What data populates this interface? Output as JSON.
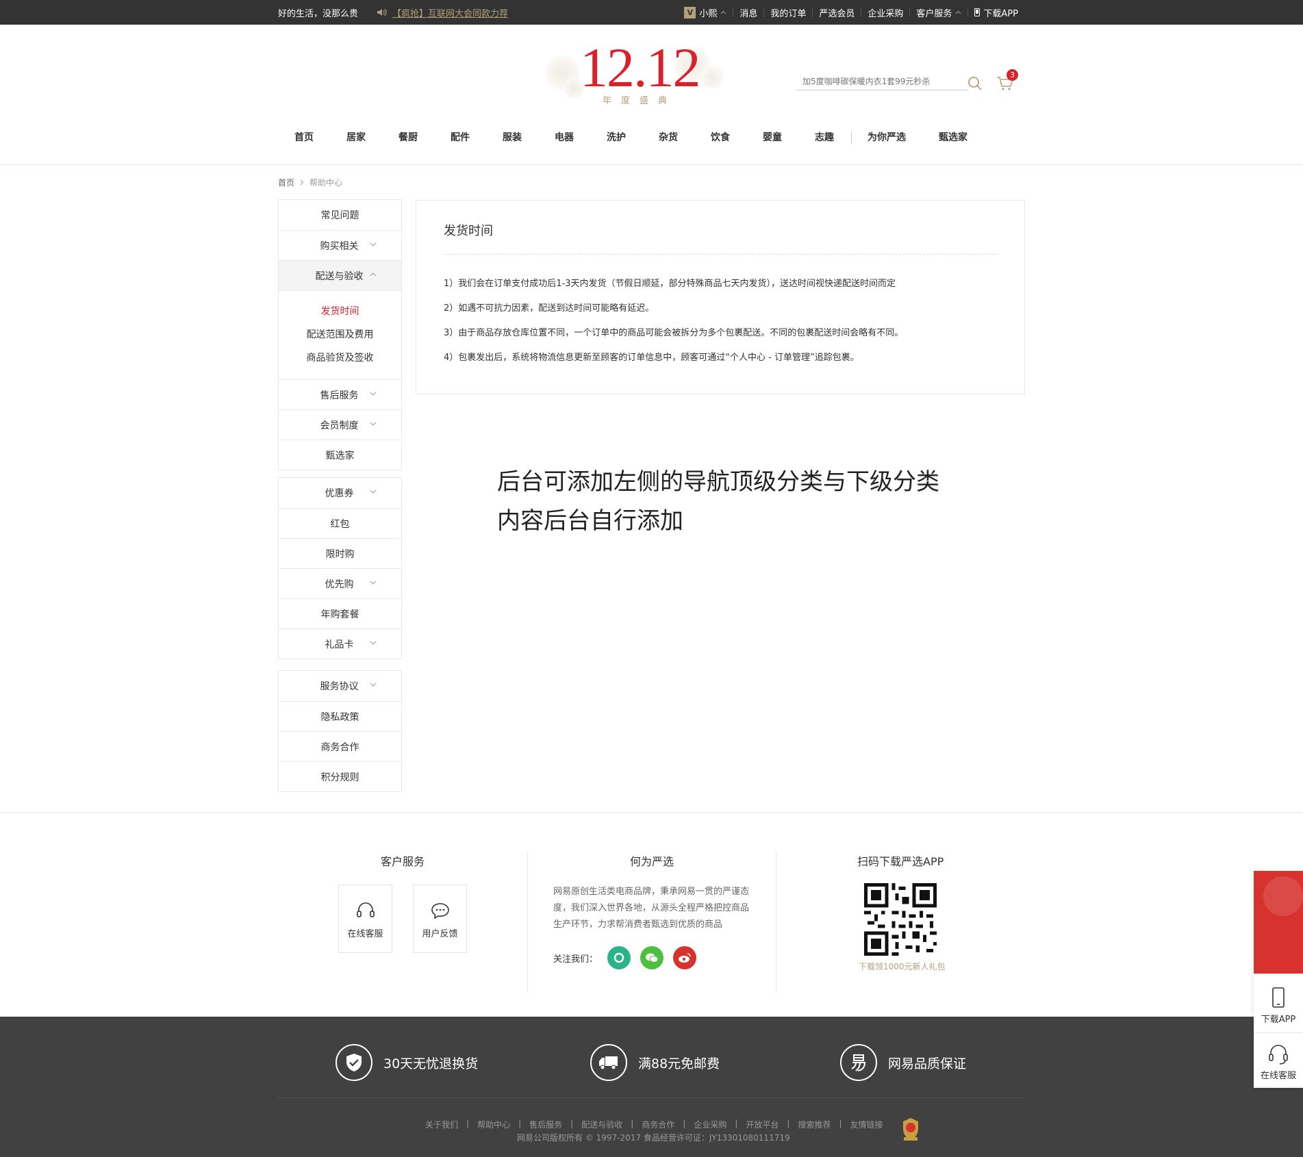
{
  "topbar": {
    "slogan": "好的生活，没那么贵",
    "notice": "【疯抢】互联网大会同款力荐",
    "user_badge": "V",
    "username": "小熙",
    "links": [
      "消息",
      "我的订单",
      "严选会员",
      "企业采购",
      "客户服务"
    ],
    "download": "下载APP"
  },
  "logo": {
    "number": "12.12",
    "sub": "年度盛典"
  },
  "search": {
    "placeholder": "加5度咖啡碳保暖内衣1套99元秒杀"
  },
  "cart": {
    "count": "3"
  },
  "nav": [
    "首页",
    "居家",
    "餐厨",
    "配件",
    "服装",
    "电器",
    "洗护",
    "杂货",
    "饮食",
    "婴童",
    "志趣",
    "为你严选",
    "甄选家"
  ],
  "breadcrumb": {
    "home": "首页",
    "current": "帮助中心"
  },
  "sidebar": {
    "group1": {
      "items_top": [
        {
          "label": "常见问题",
          "chevron": false
        },
        {
          "label": "购买相关",
          "chevron": true
        },
        {
          "label": "配送与验收",
          "chevron": "up"
        }
      ],
      "sub": [
        "发货时间",
        "配送范围及费用",
        "商品验货及签收"
      ],
      "items_bottom": [
        {
          "label": "售后服务",
          "chevron": true
        },
        {
          "label": "会员制度",
          "chevron": true
        },
        {
          "label": "甄选家",
          "chevron": false
        }
      ]
    },
    "group2": [
      {
        "label": "优惠券",
        "chevron": true
      },
      {
        "label": "红包",
        "chevron": false
      },
      {
        "label": "限时购",
        "chevron": false
      },
      {
        "label": "优先购",
        "chevron": true
      },
      {
        "label": "年购套餐",
        "chevron": false
      },
      {
        "label": "礼品卡",
        "chevron": true
      }
    ],
    "group3": [
      {
        "label": "服务协议",
        "chevron": true
      },
      {
        "label": "隐私政策",
        "chevron": false
      },
      {
        "label": "商务合作",
        "chevron": false
      },
      {
        "label": "积分规则",
        "chevron": false
      }
    ]
  },
  "content": {
    "title": "发货时间",
    "paragraphs": [
      "1）我们会在订单支付成功后1-3天内发货（节假日顺延，部分特殊商品七天内发货），送达时间视快递配送时间而定",
      "2）如遇不可抗力因素，配送到达时间可能略有延迟。",
      "3）由于商品存放仓库位置不同，一个订单中的商品可能会被拆分为多个包裹配送。不同的包裹配送时间会略有不同。",
      "4）包裹发出后，系统将物流信息更新至顾客的订单信息中，顾客可通过“个人中心 - 订单管理”追踪包裹。"
    ]
  },
  "annotation": [
    "后台可添加左侧的导航顶级分类与下级分类",
    "内容后台自行添加"
  ],
  "footer": {
    "service_title": "客户服务",
    "service_buttons": [
      "在线客服",
      "用户反馈"
    ],
    "about_title": "何为严选",
    "about_text": "网易原创生活类电商品牌，秉承网易一贯的严谨态度，我们深入世界各地，从源头全程严格把控商品生产环节，力求帮消费者甄选到优质的商品",
    "follow_label": "关注我们：",
    "qr_title": "扫码下载严选APP",
    "qr_caption": "下载领1000元新人礼包",
    "guarantees": [
      "30天无忧退换货",
      "满88元免邮费",
      "网易品质保证"
    ],
    "links": [
      "关于我们",
      "帮助中心",
      "售后服务",
      "配送与验收",
      "商务合作",
      "企业采购",
      "开放平台",
      "搜索推荐",
      "友情链接"
    ],
    "copyright": "网易公司版权所有 © 1997-2017   食品经营许可证：JY13301080111719"
  },
  "float": {
    "download": "下载APP",
    "service": "在线客服"
  },
  "colors": {
    "accent": "#d8232a",
    "gold": "#b4a078",
    "dark": "#333333",
    "footer_dark": "#414141"
  }
}
